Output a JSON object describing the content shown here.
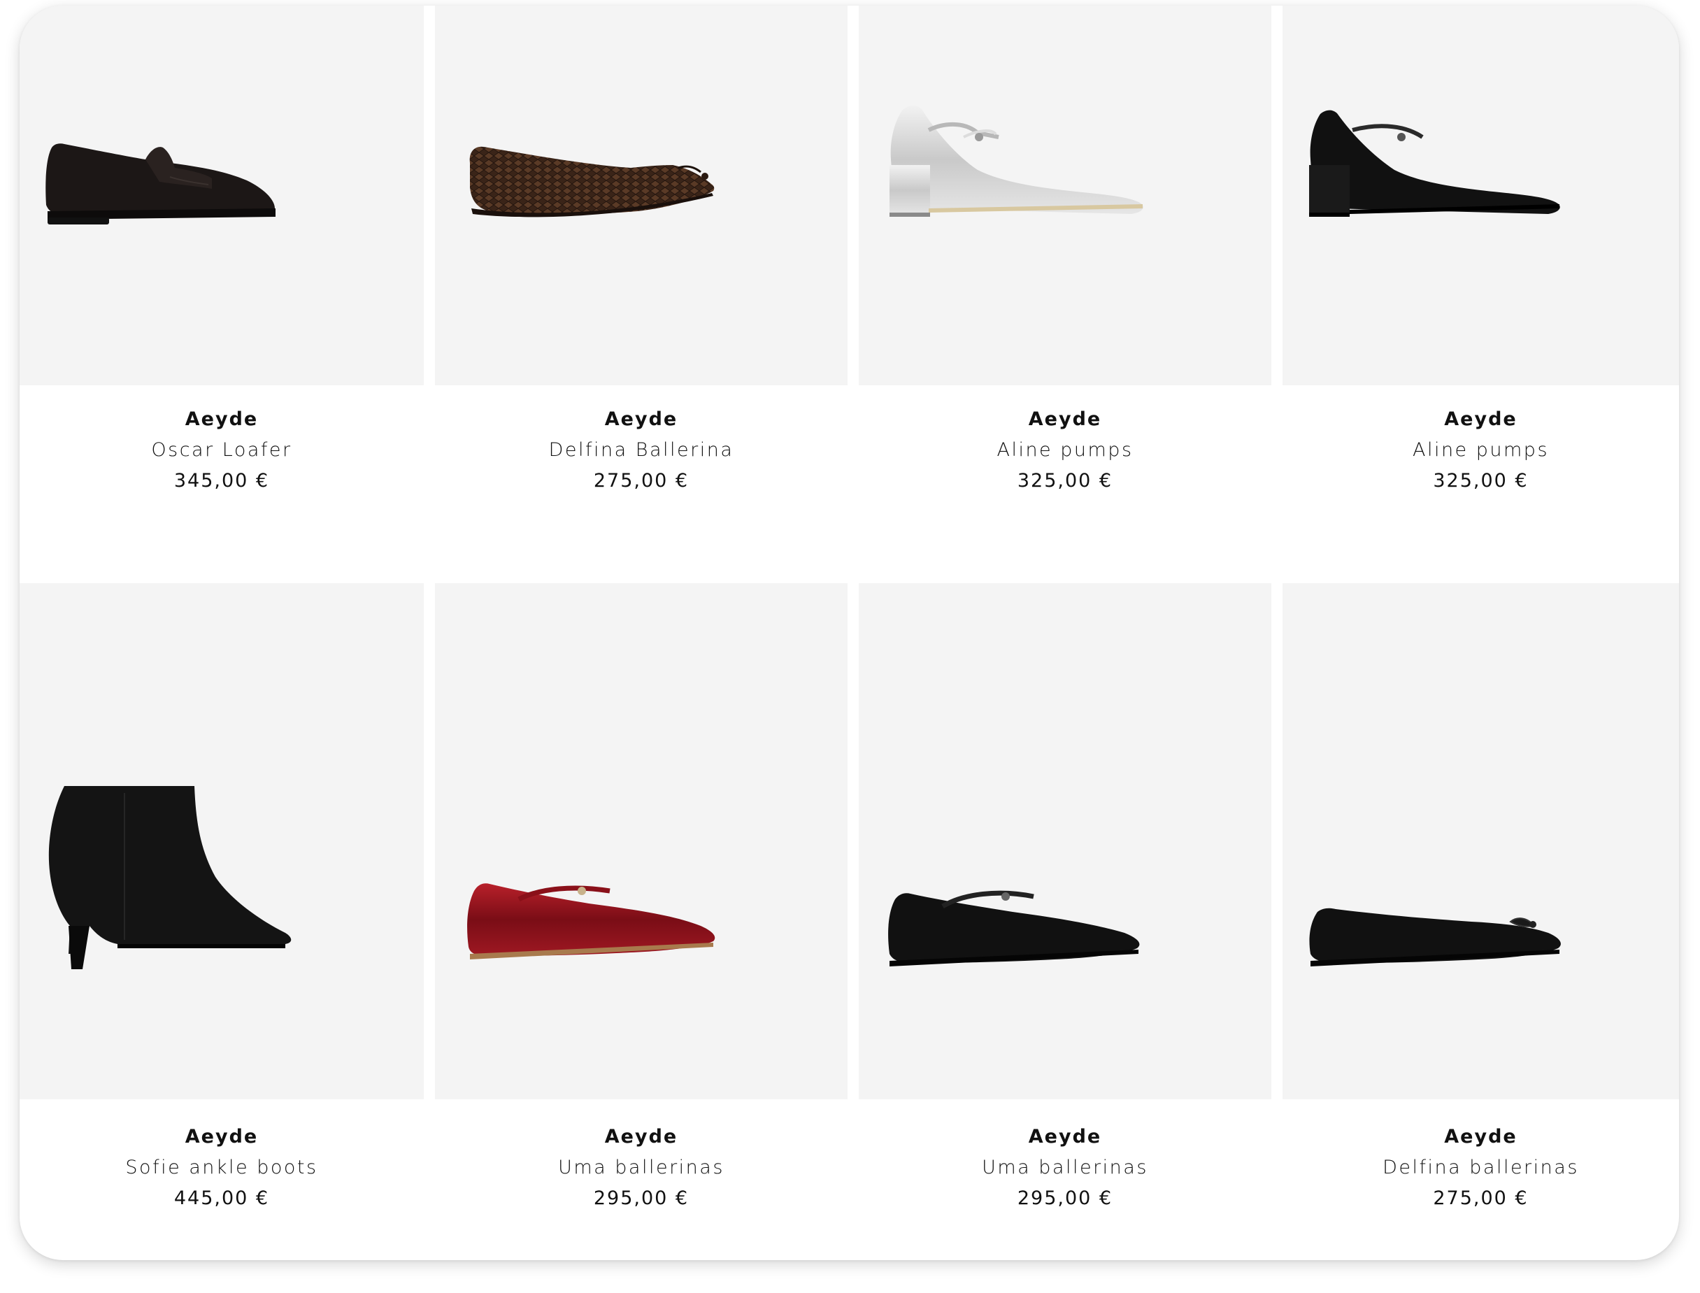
{
  "products": [
    {
      "brand": "Aeyde",
      "name": "Oscar Loafer",
      "price": "345,00 €",
      "image_icon": "black-suede-loafer"
    },
    {
      "brand": "Aeyde",
      "name": "Delfina Ballerina",
      "price": "275,00 €",
      "image_icon": "brown-snakeskin-ballerina"
    },
    {
      "brand": "Aeyde",
      "name": "Aline pumps",
      "price": "325,00 €",
      "image_icon": "silver-mary-jane-pump"
    },
    {
      "brand": "Aeyde",
      "name": "Aline pumps",
      "price": "325,00 €",
      "image_icon": "black-mary-jane-pump"
    },
    {
      "brand": "Aeyde",
      "name": "Sofie ankle boots",
      "price": "445,00 €",
      "image_icon": "black-kitten-heel-ankle-boot"
    },
    {
      "brand": "Aeyde",
      "name": "Uma ballerinas",
      "price": "295,00 €",
      "image_icon": "red-patent-mary-jane-flat"
    },
    {
      "brand": "Aeyde",
      "name": "Uma ballerinas",
      "price": "295,00 €",
      "image_icon": "black-mary-jane-flat"
    },
    {
      "brand": "Aeyde",
      "name": "Delfina ballerinas",
      "price": "275,00 €",
      "image_icon": "black-bow-ballerina"
    }
  ],
  "colors": {
    "tile_background": "#f4f4f4",
    "text": "#111111"
  }
}
